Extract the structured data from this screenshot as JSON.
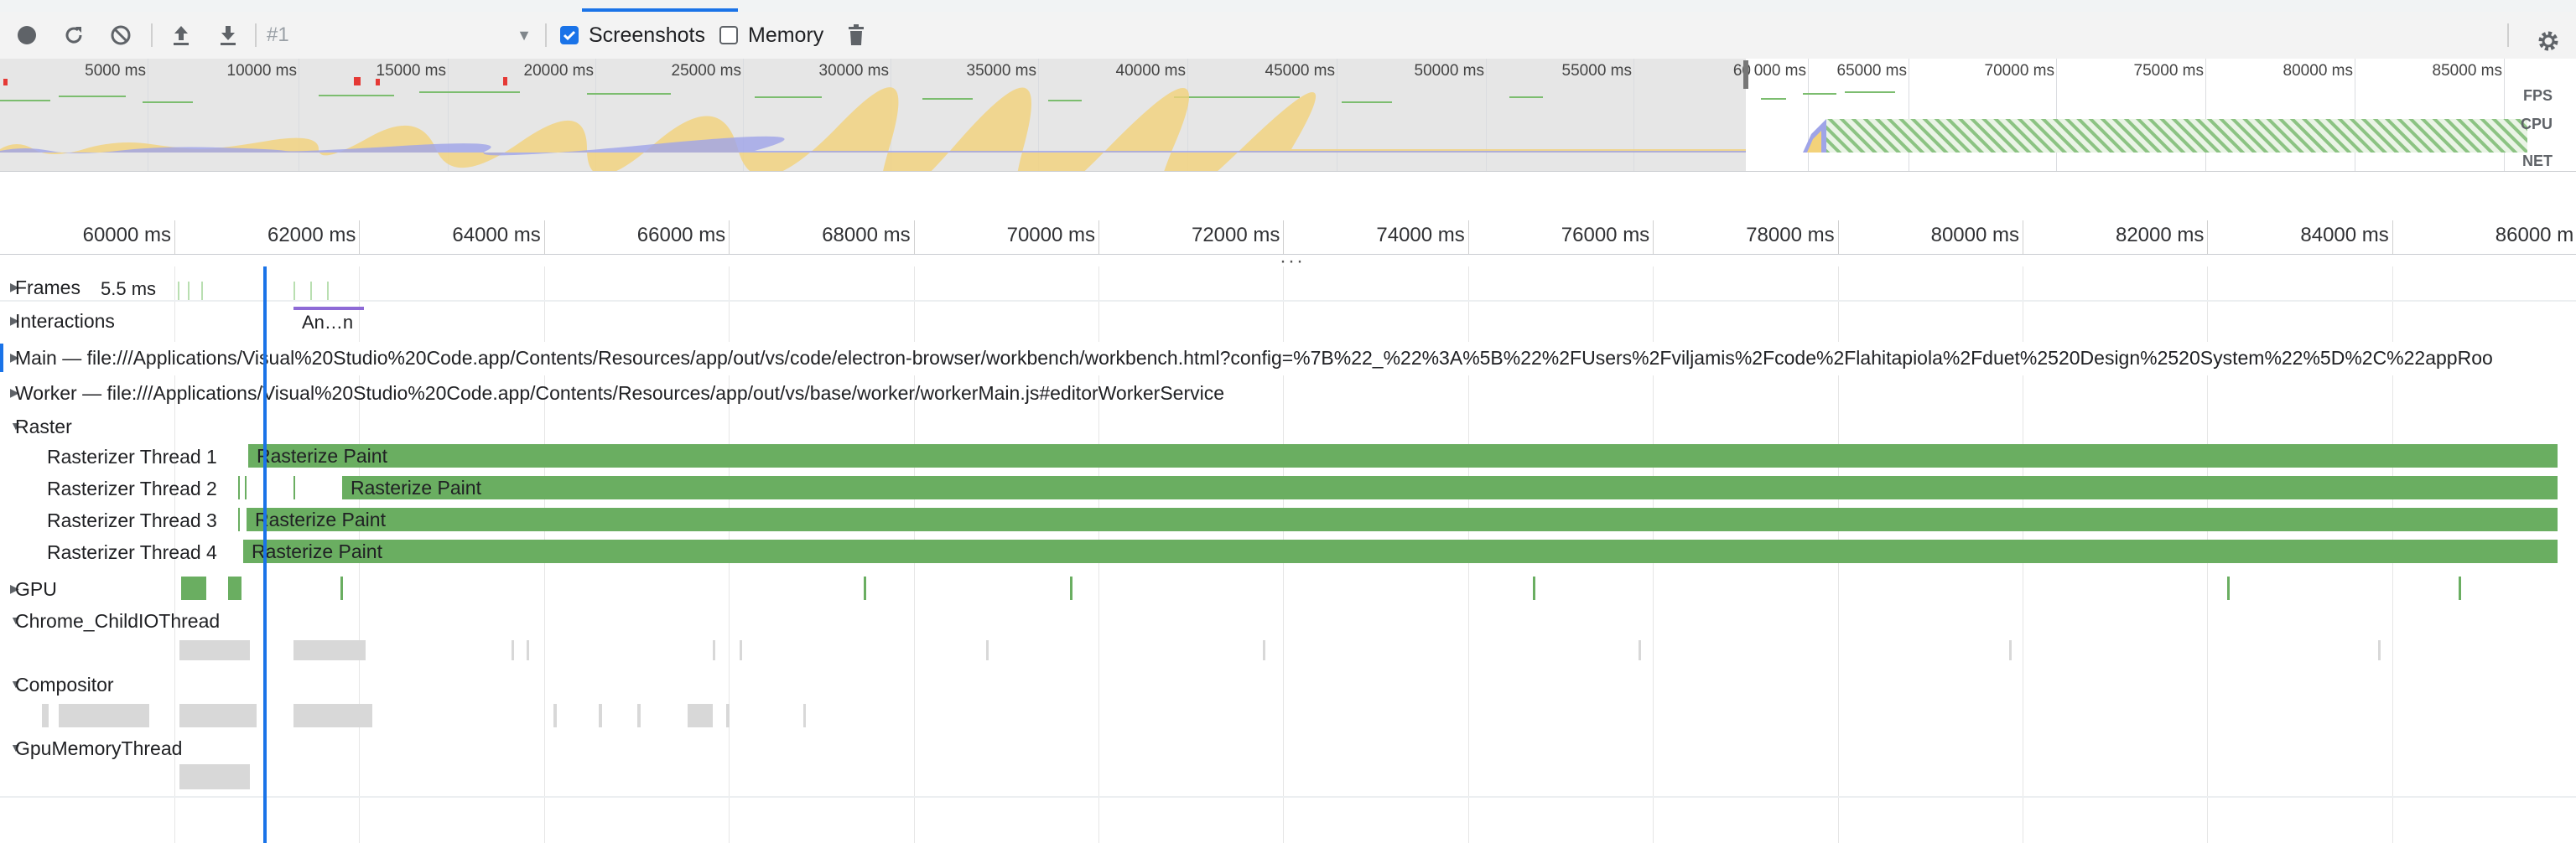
{
  "toolbar": {
    "record_title": "record-icon",
    "profile_value": "#1",
    "screenshots_label": "Screenshots",
    "memory_label": "Memory",
    "screenshots_checked": true,
    "memory_checked": false,
    "accent": "#1a73e8"
  },
  "overview": {
    "ticks": [
      "5000 ms",
      "10000 ms",
      "15000 ms",
      "20000 ms",
      "25000 ms",
      "30000 ms",
      "35000 ms",
      "40000 ms",
      "45000 ms",
      "50000 ms",
      "55000 ms",
      "60",
      "000 ms",
      "65000 ms",
      "70000 ms",
      "75000 ms",
      "80000 ms",
      "85000 ms"
    ],
    "fps_label": "FPS",
    "cpu_label": "CPU",
    "net_label": "NET"
  },
  "ruler": {
    "ticks": [
      "60000 ms",
      "62000 ms",
      "64000 ms",
      "66000 ms",
      "68000 ms",
      "70000 ms",
      "72000 ms",
      "74000 ms",
      "76000 ms",
      "78000 ms",
      "80000 ms",
      "82000 ms",
      "84000 ms",
      "86000 m"
    ]
  },
  "tracks": {
    "frames_label": "Frames",
    "frames_value": "5.5 ms",
    "interactions_label": "Interactions",
    "interaction_item": "An…n",
    "main_label": "Main — file:///Applications/Visual%20Studio%20Code.app/Contents/Resources/app/out/vs/code/electron-browser/workbench/workbench.html?config=%7B%22_%22%3A%5B%22%2FUsers%2Fviljamis%2Fcode%2Flahitapiola%2Fduet%2520Design%2520System%22%5D%2C%22appRoo",
    "worker_label": "Worker — file:///Applications/Visual%20Studio%20Code.app/Contents/Resources/app/out/vs/base/worker/workerMain.js#editorWorkerService",
    "raster_label": "Raster",
    "raster_threads": [
      {
        "name": "Rasterizer Thread 1",
        "event": "Rasterize Paint"
      },
      {
        "name": "Rasterizer Thread 2",
        "event": "Rasterize Paint"
      },
      {
        "name": "Rasterizer Thread 3",
        "event": "Rasterize Paint"
      },
      {
        "name": "Rasterizer Thread 4",
        "event": "Rasterize Paint"
      }
    ],
    "gpu_label": "GPU",
    "childio_label": "Chrome_ChildIOThread",
    "compositor_label": "Compositor",
    "gpumem_label": "GpuMemoryThread"
  }
}
